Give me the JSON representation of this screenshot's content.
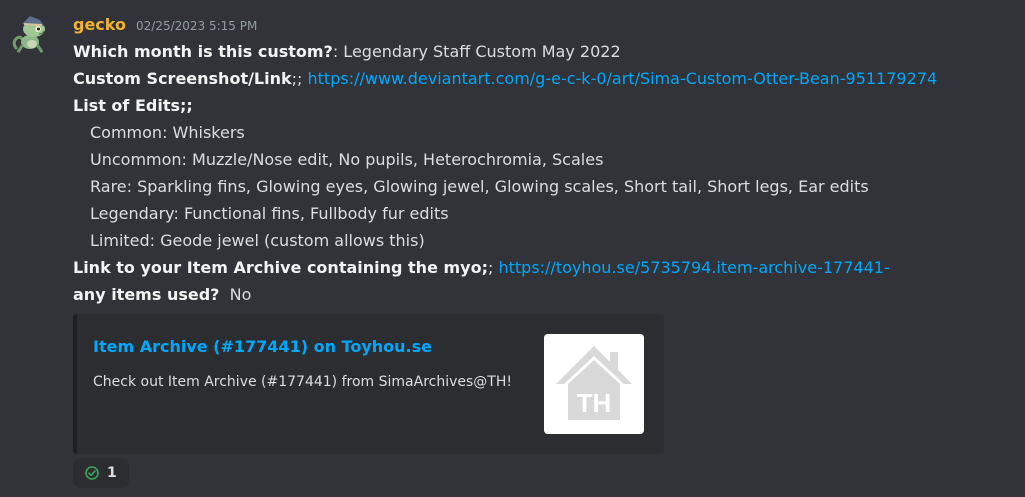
{
  "message": {
    "author": "gecko",
    "timestamp": "02/25/2023 5:15 PM",
    "author_color": "#f0b232",
    "avatar_icon": "gecko-avatar-icon",
    "lines": {
      "month_label": "Which month is this custom?",
      "month_value": ": Legendary Staff Custom May 2022",
      "screenshot_label": "Custom Screenshot/Link",
      "screenshot_sep": ";; ",
      "screenshot_url": "https://www.deviantart.com/g-e-c-k-0/art/Sima-Custom-Otter-Bean-951179274",
      "edits_label": "List of Edits;;",
      "edits": [
        "Common: Whiskers",
        "Uncommon: Muzzle/Nose edit, No pupils, Heterochromia, Scales",
        "Rare: Sparkling fins, Glowing eyes, Glowing jewel, Glowing scales, Short tail, Short legs, Ear edits",
        "Legendary: Functional fins, Fullbody fur edits",
        "Limited: Geode jewel (custom allows this)"
      ],
      "archive_label": "Link to your Item Archive containing the myo;",
      "archive_sep": "; ",
      "archive_url": "https://toyhou.se/5735794.item-archive-177441-",
      "items_label": "any items used?",
      "items_value": "  No"
    }
  },
  "embed": {
    "title": "Item Archive (#177441) on Toyhou.se",
    "description": "Check out Item Archive (#177441) from SimaArchives@TH!",
    "thumbnail_text": "TH",
    "thumbnail_icon": "toyhouse-logo-icon"
  },
  "reaction": {
    "icon": "check-mark-icon",
    "count": "1"
  },
  "colors": {
    "background": "#313338",
    "link": "#00a8fc",
    "embed_bg": "#2b2d31"
  }
}
